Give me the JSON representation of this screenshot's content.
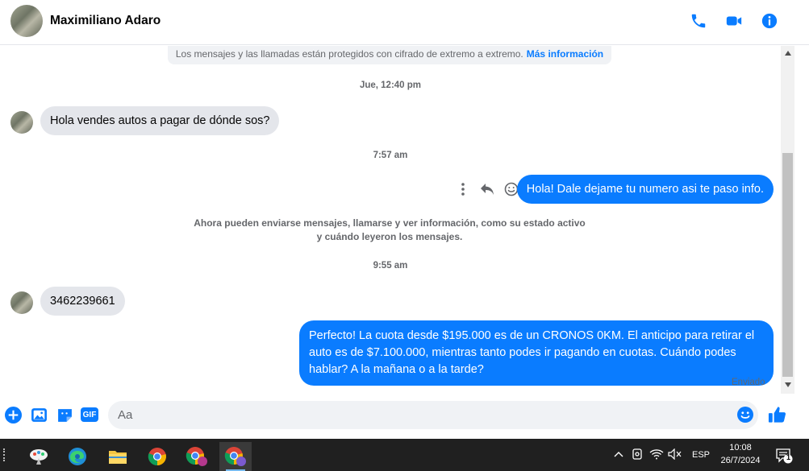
{
  "header": {
    "contact_name": "Maximiliano Adaro",
    "icons": [
      "phone-icon",
      "video-icon",
      "info-icon"
    ],
    "accent_color": "#0a7cff"
  },
  "chat": {
    "encryption_notice": "Los mensajes y las llamadas están protegidos con cifrado de extremo a extremo.",
    "encryption_link": "Más información",
    "timestamps": [
      "Jue, 12:40 pm",
      "7:57 am",
      "9:55 am"
    ],
    "system_message": "Ahora pueden enviarse mensajes, llamarse y ver información, como su estado activo y cuándo leyeron los mensajes.",
    "messages": [
      {
        "direction": "incoming",
        "text": "Hola vendes autos a pagar de dónde sos?"
      },
      {
        "direction": "outgoing",
        "text": "Hola! Dale dejame tu numero  asi te paso info."
      },
      {
        "direction": "incoming",
        "text": "3462239661"
      },
      {
        "direction": "outgoing",
        "text": "Perfecto! La cuota desde $195.000 es de un CRONOS 0KM. El anticipo para retirar el auto es de $7.100.000, mientras tanto podes ir pagando en cuotas. Cuándo podes hablar? A la mañana o a la tarde?"
      }
    ],
    "status": "Enviado"
  },
  "composer": {
    "placeholder": "Aa",
    "value": "",
    "gif_label": "GIF"
  },
  "taskbar": {
    "language": "ESP",
    "time": "10:08",
    "date": "26/7/2024",
    "notification_count": "1"
  }
}
